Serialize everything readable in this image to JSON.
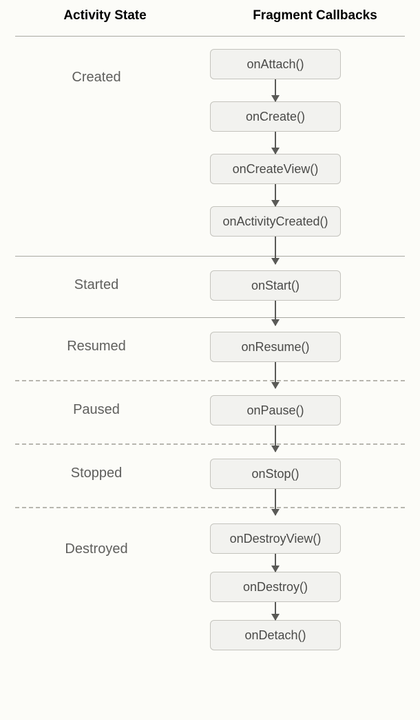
{
  "headers": {
    "left": "Activity State",
    "right": "Fragment Callbacks"
  },
  "sections": [
    {
      "state": "Created",
      "divider_before": "solid",
      "callbacks": [
        "onAttach()",
        "onCreate()",
        "onCreateView()",
        "onActivityCreated()"
      ]
    },
    {
      "state": "Started",
      "divider_before": "solid",
      "callbacks": [
        "onStart()"
      ]
    },
    {
      "state": "Resumed",
      "divider_before": "solid",
      "callbacks": [
        "onResume()"
      ]
    },
    {
      "state": "Paused",
      "divider_before": "dashed",
      "callbacks": [
        "onPause()"
      ]
    },
    {
      "state": "Stopped",
      "divider_before": "dashed",
      "callbacks": [
        "onStop()"
      ]
    },
    {
      "state": "Destroyed",
      "divider_before": "dashed",
      "callbacks": [
        "onDestroyView()",
        "onDestroy()",
        "onDetach()"
      ]
    }
  ]
}
